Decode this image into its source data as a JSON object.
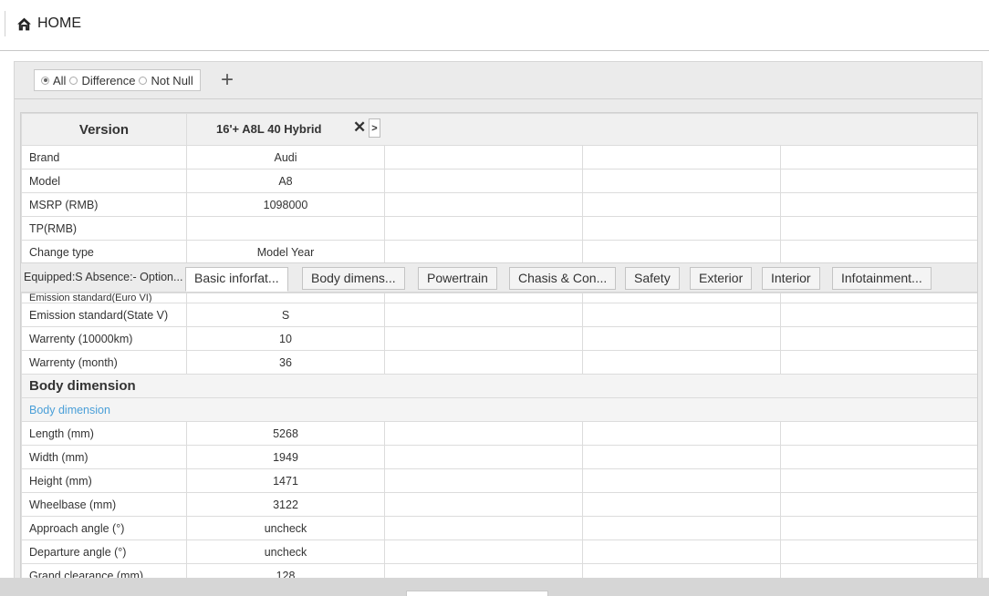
{
  "header": {
    "home_label": "HOME"
  },
  "filter": {
    "options": [
      "All",
      "Difference",
      "Not Null"
    ],
    "selected": "All",
    "add_label": "+"
  },
  "version": {
    "label": "Version",
    "car": "16'+ A8L 40 Hybrid",
    "close": "✕",
    "next": ">"
  },
  "rows_top": [
    {
      "label": "Brand",
      "value": "Audi"
    },
    {
      "label": "Model",
      "value": "A8"
    },
    {
      "label": "MSRP (RMB)",
      "value": "1098000"
    },
    {
      "label": "TP(RMB)",
      "value": ""
    },
    {
      "label": "Change type",
      "value": "Model Year"
    }
  ],
  "tabbar": {
    "legend": "Equipped:S Absence:- Option...",
    "tabs": [
      "Basic inforfat...",
      "Body dimens...",
      "Powertrain",
      "Chasis & Con...",
      "Safety",
      "Exterior",
      "Interior",
      "Infotainment..."
    ],
    "active": "Basic inforfat..."
  },
  "rows_basic": [
    {
      "label": "Emission standard(Euro VI)",
      "value": ""
    },
    {
      "label": "Emission standard(State V)",
      "value": "S"
    },
    {
      "label": "Warrenty (10000km)",
      "value": "10"
    },
    {
      "label": "Warrenty (month)",
      "value": "36"
    }
  ],
  "section_body": {
    "title": "Body dimension",
    "subtitle": "Body dimension",
    "rows": [
      {
        "label": "Length (mm)",
        "value": "5268"
      },
      {
        "label": "Width (mm)",
        "value": "1949"
      },
      {
        "label": "Height (mm)",
        "value": "1471"
      },
      {
        "label": "Wheelbase (mm)",
        "value": "3122"
      },
      {
        "label": "Approach angle (°)",
        "value": "uncheck"
      },
      {
        "label": "Departure angle (°)",
        "value": "uncheck"
      },
      {
        "label": "Grand clearance (mm)",
        "value": "128"
      }
    ]
  },
  "colors": {
    "accent_link": "#4a9fd8",
    "panel_bg": "#ebebeb"
  }
}
